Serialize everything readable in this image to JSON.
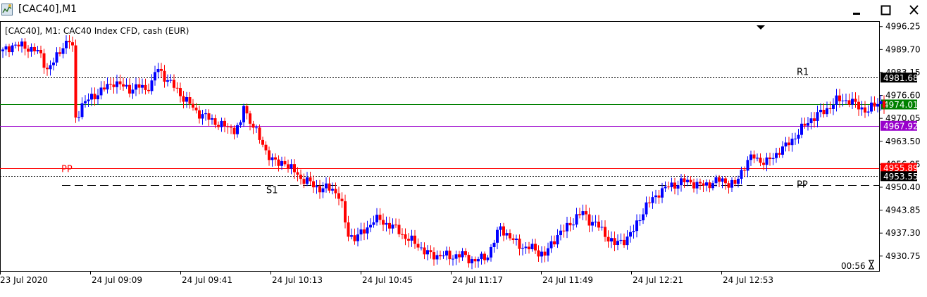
{
  "window": {
    "title": "[CAC40],M1",
    "minimize_icon": "minimize-icon",
    "maximize_icon": "maximize-icon",
    "close_icon": "close-icon"
  },
  "chart_header": "[CAC40], M1:  CAC40 Index CFD, cash (EUR)",
  "timer": "00:56",
  "colors": {
    "bull": "#0000ff",
    "bear": "#ff0000",
    "r1_line": "#000000",
    "pp_line": "#000000",
    "green_line": "#008000",
    "purple_line": "#9900cc",
    "red_line": "#ff0000",
    "ask_line": "#000000"
  },
  "chart_data": {
    "type": "candlestick",
    "symbol": "CAC40",
    "timeframe": "M1",
    "y_axis": {
      "ticks": [
        "4996.25",
        "4989.70",
        "4983.15",
        "4976.60",
        "4970.05",
        "4963.50",
        "4956.95",
        "4950.40",
        "4943.85",
        "4937.30",
        "4930.75"
      ],
      "range": [
        4927.5,
        4997.0
      ]
    },
    "x_axis": {
      "ticks": [
        "23 Jul 2020",
        "24 Jul 09:09",
        "24 Jul 09:41",
        "24 Jul 10:13",
        "24 Jul 10:45",
        "24 Jul 11:17",
        "24 Jul 11:49",
        "24 Jul 12:21",
        "24 Jul 12:53"
      ]
    },
    "price_labels": [
      {
        "value": "4981.68",
        "style": "black"
      },
      {
        "value": "4974.01",
        "style": "green"
      },
      {
        "value": "4967.92",
        "style": "purple"
      },
      {
        "value": "4955.89",
        "style": "red"
      },
      {
        "value": "4953.55",
        "style": "black"
      }
    ],
    "horizontal_lines": [
      {
        "price": 4981.68,
        "style": "dotted",
        "color": "r1_line"
      },
      {
        "price": 4974.01,
        "style": "solid",
        "color": "green_line"
      },
      {
        "price": 4967.92,
        "style": "solid",
        "color": "purple_line"
      },
      {
        "price": 4955.89,
        "style": "solid",
        "color": "red_line"
      },
      {
        "price": 4953.55,
        "style": "dotted",
        "color": "ask_line"
      },
      {
        "price": 4951.1,
        "style": "dashed",
        "color": "pp_line"
      }
    ],
    "annotations": [
      {
        "text": "R1",
        "price": 4981.68,
        "color": "#000000"
      },
      {
        "text": "PP",
        "price": 4955.89,
        "color": "#ff0000"
      },
      {
        "text": "S1",
        "price": 4951.1,
        "color": "#000000"
      },
      {
        "text": "PP",
        "price": 4951.1,
        "color": "#000000"
      }
    ],
    "close_path": [
      [
        0,
        4989
      ],
      [
        3,
        4991
      ],
      [
        7,
        4990.5
      ],
      [
        10,
        4989.5
      ],
      [
        12,
        4988
      ],
      [
        14,
        4984
      ],
      [
        16,
        4986
      ],
      [
        19,
        4991
      ],
      [
        21,
        4992
      ],
      [
        22,
        4990
      ],
      [
        23,
        4970
      ],
      [
        25,
        4974
      ],
      [
        28,
        4976
      ],
      [
        31,
        4978
      ],
      [
        33,
        4979
      ],
      [
        35,
        4980.5
      ],
      [
        38,
        4979
      ],
      [
        40,
        4978.5
      ],
      [
        43,
        4979
      ],
      [
        45,
        4978.5
      ],
      [
        47,
        4980
      ],
      [
        48,
        4983
      ],
      [
        49,
        4984
      ],
      [
        51,
        4982
      ],
      [
        53,
        4980
      ],
      [
        55,
        4978
      ],
      [
        57,
        4976
      ],
      [
        59,
        4974
      ],
      [
        61,
        4972
      ],
      [
        63,
        4971
      ],
      [
        65,
        4970
      ],
      [
        67,
        4969
      ],
      [
        69,
        4968
      ],
      [
        71,
        4967.5
      ],
      [
        73,
        4967
      ],
      [
        75,
        4968
      ],
      [
        76,
        4974
      ],
      [
        77,
        4971
      ],
      [
        79,
        4968
      ],
      [
        81,
        4964
      ],
      [
        83,
        4961
      ],
      [
        85,
        4958
      ],
      [
        87,
        4957
      ],
      [
        89,
        4958
      ],
      [
        90,
        4956
      ],
      [
        92,
        4955
      ],
      [
        94,
        4953
      ],
      [
        96,
        4952
      ],
      [
        98,
        4951
      ],
      [
        100,
        4950
      ],
      [
        102,
        4950
      ],
      [
        104,
        4950
      ],
      [
        106,
        4948
      ],
      [
        107,
        4945
      ],
      [
        108,
        4940
      ],
      [
        109,
        4937
      ],
      [
        111,
        4936
      ],
      [
        113,
        4937
      ],
      [
        115,
        4939
      ],
      [
        117,
        4941
      ],
      [
        119,
        4941
      ],
      [
        121,
        4940
      ],
      [
        123,
        4939
      ],
      [
        125,
        4938
      ],
      [
        127,
        4936
      ],
      [
        129,
        4935
      ],
      [
        131,
        4934
      ],
      [
        133,
        4932
      ],
      [
        135,
        4931
      ],
      [
        137,
        4931
      ],
      [
        139,
        4931
      ],
      [
        141,
        4930.5
      ],
      [
        143,
        4931
      ],
      [
        145,
        4931
      ],
      [
        147,
        4930
      ],
      [
        149,
        4929.5
      ],
      [
        151,
        4930
      ],
      [
        153,
        4931
      ],
      [
        155,
        4935
      ],
      [
        157,
        4939
      ],
      [
        159,
        4937
      ],
      [
        161,
        4935
      ],
      [
        163,
        4934
      ],
      [
        165,
        4933
      ],
      [
        167,
        4933
      ],
      [
        169,
        4932
      ],
      [
        171,
        4931
      ],
      [
        173,
        4934
      ],
      [
        175,
        4937
      ],
      [
        177,
        4938
      ],
      [
        179,
        4940
      ],
      [
        181,
        4942
      ],
      [
        183,
        4943
      ],
      [
        185,
        4941
      ],
      [
        187,
        4940
      ],
      [
        189,
        4938
      ],
      [
        191,
        4936
      ],
      [
        193,
        4934
      ],
      [
        195,
        4935
      ],
      [
        197,
        4936
      ],
      [
        199,
        4938
      ],
      [
        201,
        4942
      ],
      [
        203,
        4945
      ],
      [
        205,
        4947
      ],
      [
        207,
        4949
      ],
      [
        209,
        4950
      ],
      [
        211,
        4951
      ],
      [
        213,
        4951.5
      ],
      [
        215,
        4952
      ],
      [
        217,
        4952
      ],
      [
        219,
        4951
      ],
      [
        221,
        4951
      ],
      [
        223,
        4951.5
      ],
      [
        225,
        4952
      ],
      [
        227,
        4952.5
      ],
      [
        229,
        4951.5
      ],
      [
        231,
        4951
      ],
      [
        233,
        4955
      ],
      [
        235,
        4958
      ],
      [
        237,
        4959
      ],
      [
        239,
        4958
      ],
      [
        241,
        4957.5
      ],
      [
        243,
        4959
      ],
      [
        245,
        4961
      ],
      [
        247,
        4962
      ],
      [
        249,
        4964
      ],
      [
        251,
        4966
      ],
      [
        253,
        4968
      ],
      [
        255,
        4970
      ],
      [
        257,
        4971
      ],
      [
        259,
        4972
      ],
      [
        261,
        4973.5
      ],
      [
        263,
        4975
      ],
      [
        265,
        4975.5
      ],
      [
        267,
        4975
      ],
      [
        269,
        4974
      ],
      [
        271,
        4973
      ],
      [
        273,
        4972
      ],
      [
        275,
        4974
      ],
      [
        277,
        4975
      ],
      [
        278,
        4974
      ]
    ]
  }
}
